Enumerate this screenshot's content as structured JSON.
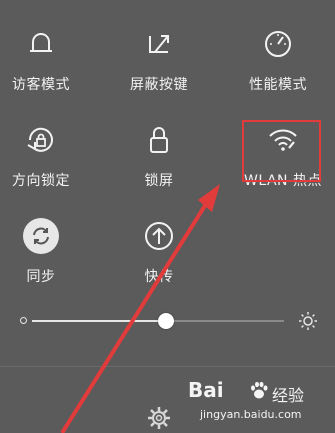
{
  "tiles": {
    "visitor_mode": "访客模式",
    "block_keys": "屏蔽按键",
    "performance_mode": "性能模式",
    "rotation_lock": "方向锁定",
    "lock_screen": "锁屏",
    "wlan_hotspot": "WLAN 热点",
    "sync": "同步",
    "quick_share": "快传"
  },
  "brightness": {
    "level": 0.53
  },
  "watermark": {
    "logo": "Bai",
    "logo_suffix": "经验",
    "url": "jingyan.baidu.com"
  },
  "colors": {
    "background": "#5b5b5b",
    "highlight": "#e23b3b",
    "text": "#f2f2f2"
  },
  "icons": [
    "visitor-icon",
    "block-keys-icon",
    "performance-icon",
    "rotation-lock-icon",
    "lock-icon",
    "wifi-hotspot-icon",
    "sync-icon",
    "upload-icon",
    "brightness-sun-icon",
    "gear-icon"
  ]
}
